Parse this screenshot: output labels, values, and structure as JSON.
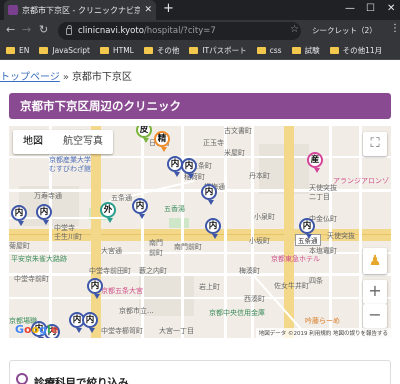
{
  "browser": {
    "tab_title": "京都市下京区 - クリニックナビ京都",
    "url_host": "clinicnavi.kyoto",
    "url_path": "/hospital/?city=7",
    "incognito_label": "シークレット（2）",
    "icons": {
      "back": "back-arrow-icon",
      "forward": "forward-arrow-icon",
      "reload": "reload-icon",
      "lock": "lock-icon",
      "star": "bookmark-star-icon",
      "menu": "kebab-menu-icon"
    }
  },
  "bookmarks": [
    "EN",
    "JavaScript",
    "HTML",
    "その他",
    "ITパスポート",
    "css",
    "試験",
    "その他11月"
  ],
  "page": {
    "breadcrumb": {
      "home": "トップページ",
      "separator": "»",
      "current": "京都市下京区"
    },
    "heading": "京都市下京区周辺のクリニック",
    "heading_color": "#8a4a91",
    "section_card": "診療科目で絞り込み"
  },
  "map": {
    "map_type_options": [
      "地図",
      "航空写真"
    ],
    "selected_map_type": "地図",
    "zoom_in": "+",
    "zoom_out": "−",
    "attribution": "地図データ ©2019  利用規約  地図の誤りを報告する",
    "google_logo": "Google",
    "labels": [
      "古文書町",
      "上五条町",
      "米屋町",
      "京都産業大学\nむすびわざ館",
      "万寿寺通",
      "五条通",
      "五条通",
      "五香湯",
      "中堂寺\n壬生川町",
      "平安京朱雀大路跡",
      "小泉町",
      "天使突抜\n二丁目",
      "中金仏町",
      "南門前町",
      "梅湊町",
      "京都東急ホテル",
      "佐女牛井町",
      "中堂寺前田町",
      "京都五条大宮",
      "大宮一丁目",
      "吟藤らーめ",
      "天使突抜",
      "アランジアロンゾ",
      "稲荷町",
      "丹本町",
      "菊屋町",
      "藪之内町",
      "中堂寺前町",
      "日吉町",
      "正玉寺",
      "京都中央信用金庫",
      "京都市立...",
      "本塩竈町",
      "中堂寺櫛笥町",
      "西湊町",
      "小坂町",
      "楊梅通",
      "大宮通",
      "岩上町",
      "四条",
      "南門",
      "前町",
      "京都場職"
    ],
    "markers": [
      {
        "kind": "皮",
        "color": "green"
      },
      {
        "kind": "精",
        "color": "orange"
      },
      {
        "kind": "内",
        "color": "blue"
      },
      {
        "kind": "内",
        "color": "blue"
      },
      {
        "kind": "産",
        "color": "pink"
      },
      {
        "kind": "内",
        "color": "blue"
      },
      {
        "kind": "内",
        "color": "blue"
      },
      {
        "kind": "外",
        "color": "teal"
      },
      {
        "kind": "内",
        "color": "blue"
      },
      {
        "kind": "内",
        "color": "blue"
      },
      {
        "kind": "内",
        "color": "blue"
      },
      {
        "kind": "内",
        "color": "blue"
      },
      {
        "kind": "内",
        "color": "blue"
      },
      {
        "kind": "内",
        "color": "blue"
      },
      {
        "kind": "内",
        "color": "blue"
      },
      {
        "kind": "内",
        "color": "blue"
      },
      {
        "kind": "内",
        "color": "blue"
      }
    ]
  }
}
